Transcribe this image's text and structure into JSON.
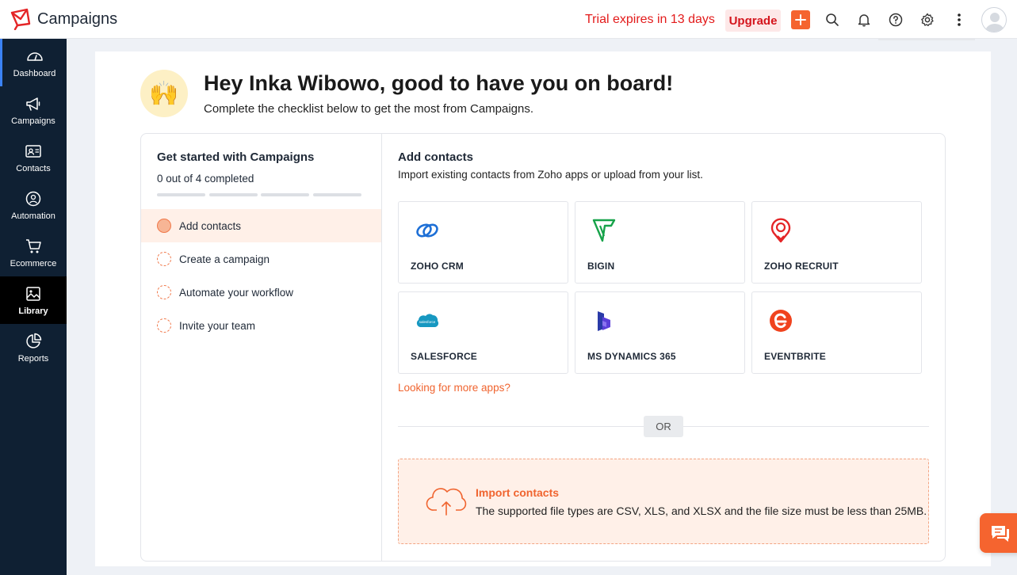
{
  "header": {
    "app_title": "Campaigns",
    "trial_text": "Trial expires in 13 days",
    "upgrade_label": "Upgrade",
    "icons": [
      "plus-icon",
      "search-icon",
      "bell-icon",
      "help-icon",
      "gear-icon",
      "more-vertical-icon",
      "avatar"
    ]
  },
  "sidebar": {
    "items": [
      {
        "label": "Dashboard",
        "icon": "dashboard-icon"
      },
      {
        "label": "Campaigns",
        "icon": "megaphone-icon"
      },
      {
        "label": "Contacts",
        "icon": "contact-card-icon"
      },
      {
        "label": "Automation",
        "icon": "automation-icon"
      },
      {
        "label": "Ecommerce",
        "icon": "cart-icon"
      },
      {
        "label": "Library",
        "icon": "image-icon"
      },
      {
        "label": "Reports",
        "icon": "pie-chart-icon"
      }
    ]
  },
  "greeting": {
    "emoji": "🙌",
    "title": "Hey Inka Wibowo, good to have you on board!",
    "subtitle": "Complete the checklist below to get the most from Campaigns."
  },
  "checklist": {
    "title": "Get started with Campaigns",
    "progress_text": "0 out of 4 completed",
    "completed": 0,
    "total": 4,
    "steps": [
      {
        "label": "Add contacts",
        "active": true
      },
      {
        "label": "Create a campaign",
        "active": false
      },
      {
        "label": "Automate your workflow",
        "active": false
      },
      {
        "label": "Invite your team",
        "active": false
      }
    ]
  },
  "add_contacts": {
    "title": "Add contacts",
    "subtitle": "Import existing contacts from Zoho apps or upload from your list.",
    "apps": [
      {
        "name": "ZOHO CRM",
        "icon": "zoho-crm-icon"
      },
      {
        "name": "BIGIN",
        "icon": "bigin-icon"
      },
      {
        "name": "ZOHO RECRUIT",
        "icon": "zoho-recruit-icon"
      },
      {
        "name": "SALESFORCE",
        "icon": "salesforce-icon"
      },
      {
        "name": "MS DYNAMICS 365",
        "icon": "ms-dynamics-icon"
      },
      {
        "name": "EVENTBRITE",
        "icon": "eventbrite-icon"
      }
    ],
    "more_apps_link": "Looking for more apps?",
    "or_label": "OR",
    "import": {
      "title": "Import contacts",
      "description": "The supported file types are CSV, XLS, and XLSX and the file size must be less than 25MB."
    }
  },
  "colors": {
    "accent": "#f5642f",
    "sidebar_bg": "#0f2033",
    "trial_red": "#e31b1b"
  }
}
